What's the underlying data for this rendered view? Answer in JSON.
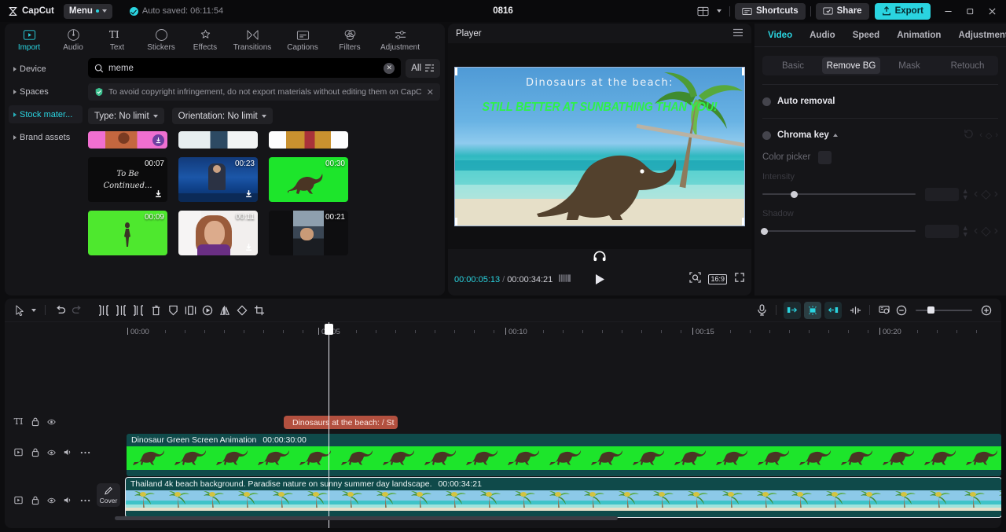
{
  "titlebar": {
    "brand": "CapCut",
    "menu_label": "Menu",
    "autosave": "Auto saved: 06:11:54",
    "project_title": "0816",
    "shortcuts_label": "Shortcuts",
    "share_label": "Share",
    "export_label": "Export",
    "minimize": "–",
    "maximize": "❐",
    "close": "✕"
  },
  "tabs": [
    {
      "label": "Import",
      "icon": "import-icon",
      "active": true
    },
    {
      "label": "Audio",
      "icon": "audio-icon",
      "active": false
    },
    {
      "label": "Text",
      "icon": "text-icon",
      "active": false
    },
    {
      "label": "Stickers",
      "icon": "stickers-icon",
      "active": false
    },
    {
      "label": "Effects",
      "icon": "effects-icon",
      "active": false
    },
    {
      "label": "Transitions",
      "icon": "transitions-icon",
      "active": false
    },
    {
      "label": "Captions",
      "icon": "captions-icon",
      "active": false
    },
    {
      "label": "Filters",
      "icon": "filters-icon",
      "active": false
    },
    {
      "label": "Adjustment",
      "icon": "adjustment-icon",
      "active": false
    }
  ],
  "sources": [
    {
      "label": "Device",
      "active": false
    },
    {
      "label": "Spaces",
      "active": false
    },
    {
      "label": "Stock mater...",
      "active": true
    },
    {
      "label": "Brand assets",
      "active": false
    }
  ],
  "search": {
    "value": "meme",
    "placeholder": "Search",
    "clear": "✕",
    "all_label": "All"
  },
  "notice": {
    "text": "To avoid copyright infringement, do not export materials without editing them on CapC",
    "close": "✕"
  },
  "filters": [
    {
      "label": "Type: No limit"
    },
    {
      "label": "Orientation: No limit"
    }
  ],
  "media_grid": [
    {
      "duration": "",
      "kind": "pink-laugh",
      "download": true
    },
    {
      "duration": "",
      "kind": "white-person",
      "download": false
    },
    {
      "duration": "",
      "kind": "tan-jacket",
      "download": false
    },
    {
      "duration": "00:07",
      "kind": "to-be-continued",
      "download": true,
      "caption1": "To Be",
      "caption2": "Continued..."
    },
    {
      "duration": "00:23",
      "kind": "news-anchor",
      "download": true
    },
    {
      "duration": "00:30",
      "kind": "green-dino",
      "download": false
    },
    {
      "duration": "00:09",
      "kind": "green-figure",
      "download": false
    },
    {
      "duration": "00:11",
      "kind": "hair-flip",
      "download": true
    },
    {
      "duration": "00:21",
      "kind": "reaction-guy",
      "download": false
    }
  ],
  "player": {
    "title": "Player",
    "menu_icon": "hamburger-icon",
    "video_title": "Dinosaurs at the beach:",
    "video_subtitle": "STILL BETTER AT SUNBATHING THAN YOU!",
    "current_time": "00:00:05:13",
    "separator": "/",
    "total_time": "00:00:34:21",
    "play_icon": "play-icon",
    "ratio": "16:9",
    "headphone_icon": "headphone-icon",
    "frames_icon": "frames-icon",
    "zoom_icon": "zoom-fit-icon",
    "fullscreen_icon": "fullscreen-icon"
  },
  "inspector": {
    "tabs": [
      {
        "label": "Video",
        "active": true
      },
      {
        "label": "Audio",
        "active": false
      },
      {
        "label": "Speed",
        "active": false
      },
      {
        "label": "Animation",
        "active": false
      },
      {
        "label": "Adjustment",
        "active": false
      }
    ],
    "segments": [
      {
        "label": "Basic",
        "active": false
      },
      {
        "label": "Remove BG",
        "active": true
      },
      {
        "label": "Mask",
        "active": false
      },
      {
        "label": "Retouch",
        "active": false
      }
    ],
    "auto_removal": "Auto removal",
    "chroma_key": "Chroma key",
    "color_picker": "Color picker",
    "intensity": "Intensity",
    "shadow": "Shadow",
    "intensity_value": "",
    "shadow_value": ""
  },
  "timeline": {
    "tools": [
      {
        "name": "select-tool",
        "glyph": "cursor"
      },
      {
        "name": "select-dropdown",
        "glyph": "chevron"
      },
      {
        "name": "undo",
        "glyph": "undo"
      },
      {
        "name": "redo",
        "glyph": "redo",
        "disabled": true
      },
      {
        "name": "split",
        "glyph": "split"
      },
      {
        "name": "trim-left",
        "glyph": "trim-left"
      },
      {
        "name": "trim-right",
        "glyph": "trim-right"
      },
      {
        "name": "delete",
        "glyph": "trash"
      },
      {
        "name": "mark",
        "glyph": "shield"
      },
      {
        "name": "freeze",
        "glyph": "freeze"
      },
      {
        "name": "reverse",
        "glyph": "reverse"
      },
      {
        "name": "mirror",
        "glyph": "mirror"
      },
      {
        "name": "rotate",
        "glyph": "rotate"
      },
      {
        "name": "crop",
        "glyph": "crop"
      }
    ],
    "right_tools": [
      {
        "name": "record-voiceover",
        "glyph": "mic"
      },
      {
        "name": "auto-snap-start",
        "glyph": "snap-in",
        "accent": true
      },
      {
        "name": "magnetic-snap",
        "glyph": "magnet",
        "accent": true,
        "on": true
      },
      {
        "name": "auto-snap-end",
        "glyph": "snap-out",
        "accent": true
      },
      {
        "name": "link-clip",
        "glyph": "link"
      },
      {
        "name": "preview-thumbnail",
        "glyph": "thumb"
      },
      {
        "name": "zoom-out",
        "glyph": "minus"
      },
      {
        "name": "zoom-in",
        "glyph": "plus"
      }
    ],
    "ruler": [
      "00:00",
      "00:05",
      "00:10",
      "00:15",
      "00:20"
    ],
    "playhead_time": "00:00:05:13",
    "cover_label": "Cover",
    "clips": {
      "text": {
        "label": "Dinosaurs at the beach:  / St",
        "icon": "text-clip-icon"
      },
      "overlay": {
        "name": "Dinosaur Green Screen Animation",
        "duration": "00:00:30:00"
      },
      "main": {
        "name": "Thailand 4k beach background. Paradise nature on sunny summer day landscape.",
        "duration": "00:00:34:21"
      }
    },
    "track_headers": [
      {
        "type": "text",
        "glyph": "TI",
        "lock": "lock-icon",
        "eye": "eye-icon"
      },
      {
        "type": "video",
        "glyph": "video-icon",
        "lock": "lock-icon",
        "eye": "eye-icon",
        "volume": "volume-icon",
        "more": "more-icon"
      },
      {
        "type": "video",
        "glyph": "video-icon",
        "lock": "lock-icon",
        "eye": "eye-icon",
        "volume": "volume-icon",
        "more": "more-icon"
      }
    ]
  },
  "colors": {
    "accent": "#2ad4e0",
    "text_clip": "#b2503f",
    "video_clip": "#0f4a4a",
    "green_screen": "#1de52b"
  }
}
